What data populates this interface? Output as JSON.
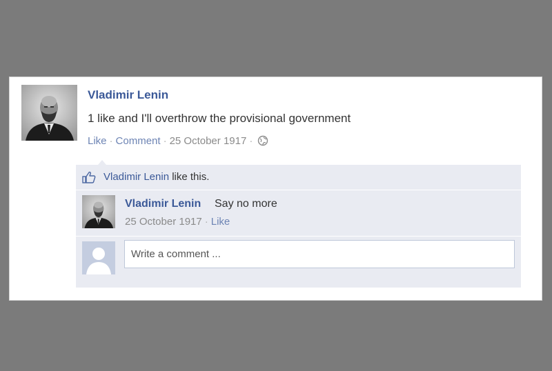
{
  "post": {
    "author": "Vladimir Lenin",
    "text": "1 like and I'll overthrow the provisional government",
    "actions": {
      "like": "Like",
      "comment": "Comment",
      "date": "25 October 1917",
      "privacy_icon": "globe-icon"
    }
  },
  "likes": {
    "icon": "thumbs-up-icon",
    "name": "Vladimir Lenin",
    "suffix": "like this."
  },
  "comment": {
    "author": "Vladimir Lenin",
    "text": "Say no more",
    "date": "25 October 1917",
    "like": "Like"
  },
  "composer": {
    "placeholder": "Write a comment ..."
  },
  "colors": {
    "background": "#7b7b7b",
    "link": "#3b5998",
    "ufi_background": "#e9ebf2"
  }
}
